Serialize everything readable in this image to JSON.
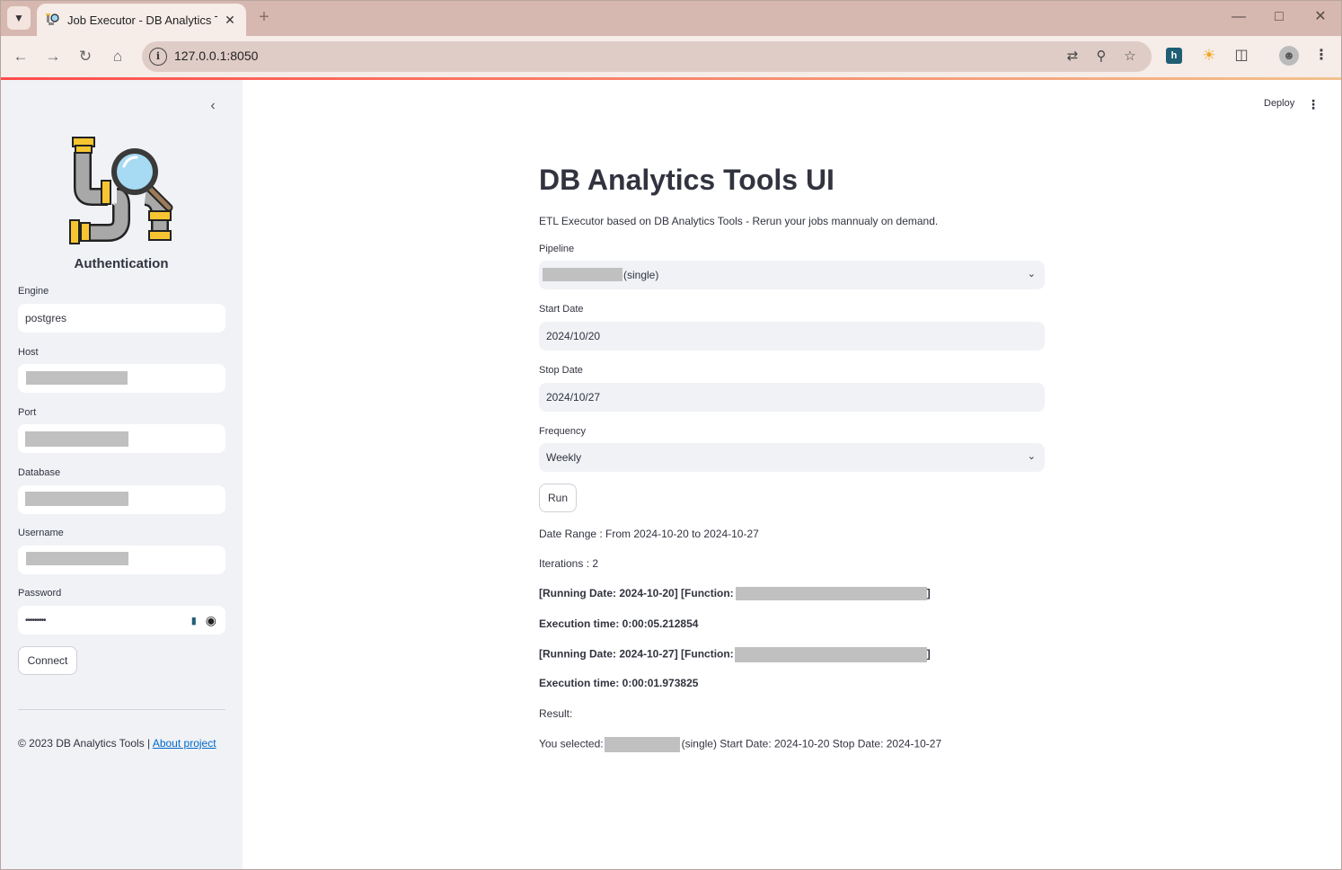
{
  "browser": {
    "tab_title": "Job Executor - DB Analytics Too",
    "url": "127.0.0.1:8050"
  },
  "sidebar": {
    "title": "Authentication",
    "fields": {
      "engine": {
        "label": "Engine",
        "value": "postgres"
      },
      "host": {
        "label": "Host"
      },
      "port": {
        "label": "Port"
      },
      "database": {
        "label": "Database"
      },
      "username": {
        "label": "Username"
      },
      "password": {
        "label": "Password",
        "value": "•••••••••"
      }
    },
    "connect_label": "Connect",
    "footer_text": "© 2023 DB Analytics Tools | ",
    "footer_link": "About project"
  },
  "header": {
    "deploy_label": "Deploy"
  },
  "main": {
    "title": "DB Analytics Tools UI",
    "subtitle": "ETL Executor based on DB Analytics Tools - Rerun your jobs mannualy on demand.",
    "pipeline": {
      "label": "Pipeline",
      "value_suffix": "(single)"
    },
    "start_date": {
      "label": "Start Date",
      "value": "2024/10/20"
    },
    "stop_date": {
      "label": "Stop Date",
      "value": "2024/10/27"
    },
    "frequency": {
      "label": "Frequency",
      "value": "Weekly"
    },
    "run_label": "Run",
    "output": {
      "date_range": "Date Range : From 2024-10-20 to 2024-10-27",
      "iterations": "Iterations : 2",
      "run1_prefix": "[Running Date: 2024-10-20] [Function:",
      "run1_suffix": "]",
      "exec1": "Execution time: 0:00:05.212854",
      "run2_prefix": "[Running Date: 2024-10-27] [Function:",
      "run2_suffix": "]",
      "exec2": "Execution time: 0:00:01.973825",
      "result": "Result:",
      "selected_prefix": "You selected:",
      "selected_suffix": "(single) Start Date: 2024-10-20 Stop Date: 2024-10-27"
    }
  },
  "colors": {
    "accent_red": "#ff4b4b",
    "link_blue": "#0068c9",
    "sidebar_bg": "#f0f2f6",
    "text": "#31333f"
  }
}
